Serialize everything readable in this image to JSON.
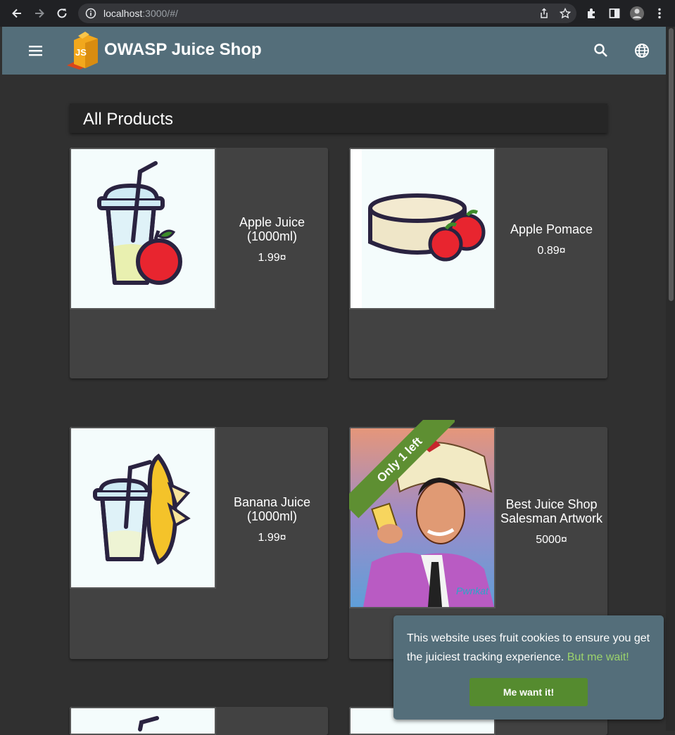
{
  "browser": {
    "url_host": "localhost",
    "url_path": ":3000/#/"
  },
  "app": {
    "title": "OWASP Juice Shop",
    "accent_color": "#546e7a"
  },
  "page": {
    "heading": "All Products"
  },
  "products": [
    {
      "name": "Apple Juice (1000ml)",
      "price": "1.99¤"
    },
    {
      "name": "Apple Pomace",
      "price": "0.89¤"
    },
    {
      "name": "Banana Juice (1000ml)",
      "price": "1.99¤"
    },
    {
      "name": "Best Juice Shop Salesman Artwork",
      "price": "5000¤",
      "badge": "Only 1 left"
    }
  ],
  "cookie_banner": {
    "message": "This website uses fruit cookies to ensure you get the juiciest tracking experience.",
    "link_label": "But me wait!",
    "accept_label": "Me want it!"
  }
}
